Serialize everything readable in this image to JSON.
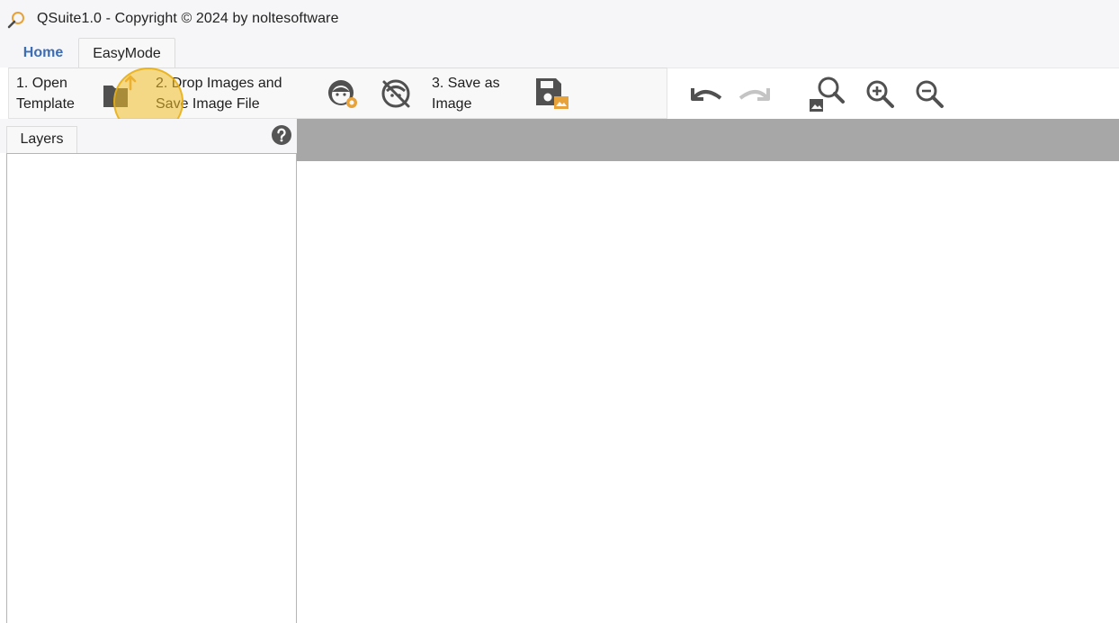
{
  "window": {
    "title": "QSuite1.0 - Copyright © 2024 by noltesoftware",
    "app_icon": "magnifier-icon"
  },
  "ribbon_tabs": [
    {
      "label": "Home",
      "active": false
    },
    {
      "label": "EasyMode",
      "active": true
    }
  ],
  "ribbon": {
    "open_template_label": "1. Open\nTemplate",
    "open_template_line1": "1. Open",
    "open_template_line2": "Template",
    "open_template_icon": "folder-upload-icon",
    "drop_images_line1": "2. Drop Images and",
    "drop_images_line2": "Save Image File",
    "face_detect_icon": "face-eye-icon",
    "face_hide_icon": "face-hidden-icon",
    "save_as_line1": "3. Save as",
    "save_as_line2": "Image",
    "save_as_icon": "save-image-icon",
    "undo_icon": "undo-icon",
    "redo_icon": "redo-icon",
    "zoom_fit_icon": "zoom-image-icon",
    "zoom_in_icon": "zoom-in-icon",
    "zoom_out_icon": "zoom-out-icon"
  },
  "layers_panel": {
    "tab_label": "Layers",
    "help_icon": "help-icon",
    "items": []
  },
  "colors": {
    "accent_home": "#3d6db3",
    "highlight": "#f0be28",
    "canvas_header": "#a7a7a7",
    "icon_dark": "#505050",
    "icon_orange": "#e8a23a"
  }
}
